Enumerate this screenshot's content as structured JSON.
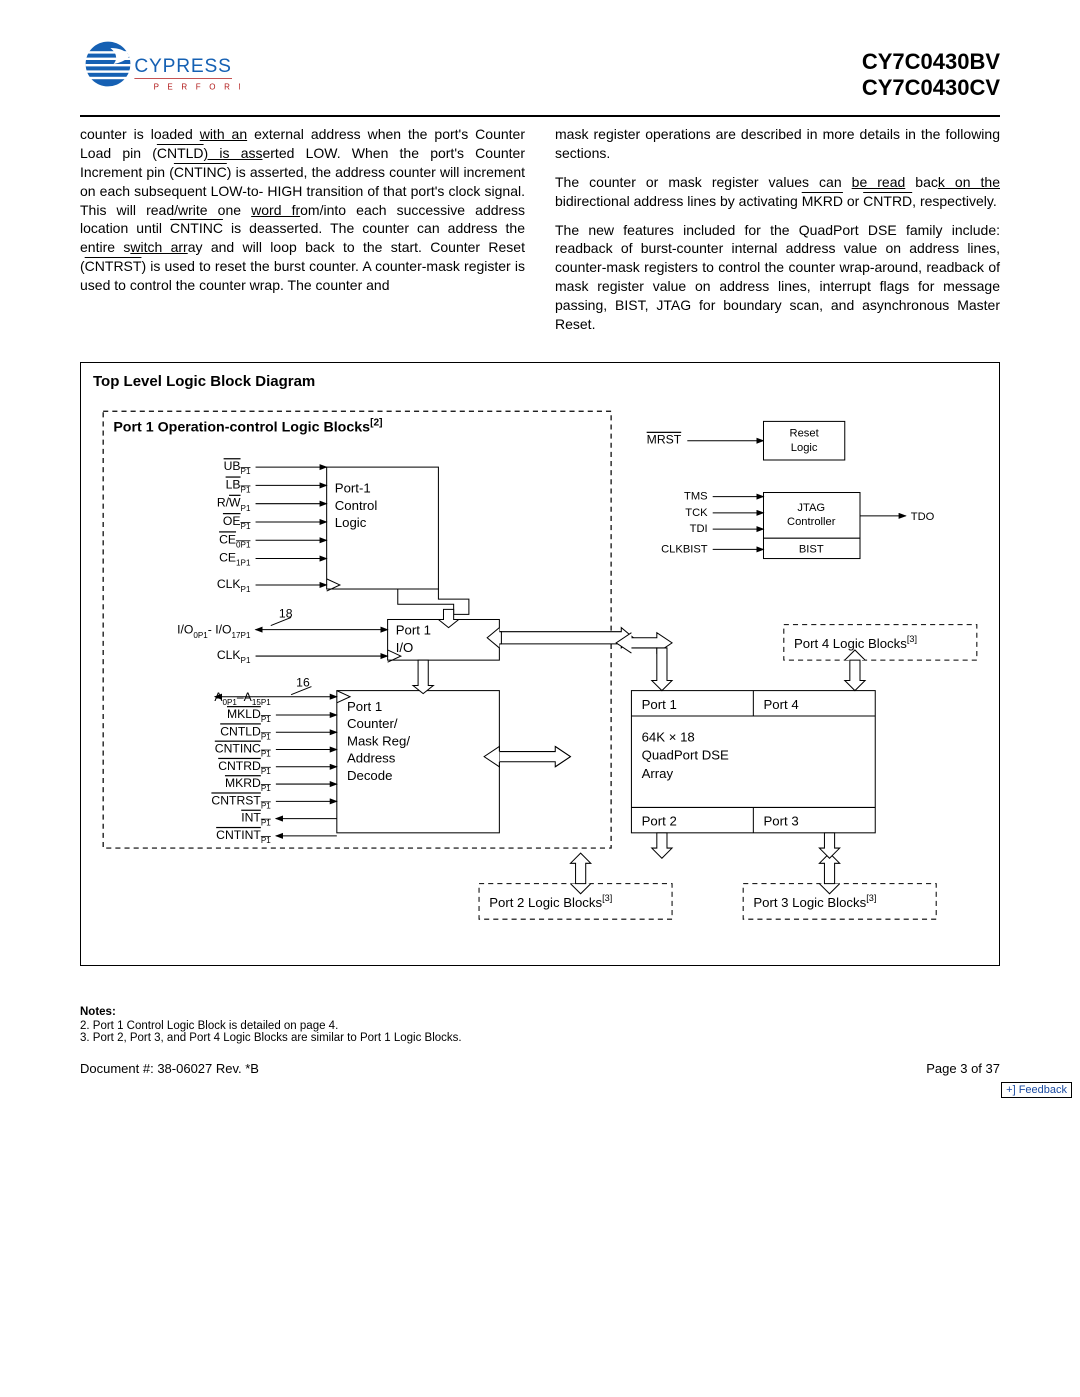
{
  "header": {
    "part1": "CY7C0430BV",
    "part2": "CY7C0430CV",
    "logo_name": "CYPRESS",
    "logo_tag": "P E R F O R M"
  },
  "body": {
    "left_para": "counter is loaded with an external address when the port's Counter Load pin (CNTLD) is asserted LOW. When the port's Counter Increment pin (CNTINC) is asserted, the address counter will increment on each subsequent LOW-to- HIGH transition of that port's clock signal. This will read/write one word from/into each successive address location until CNTINC is deasserted. The counter can address the entire switch array and will loop back to the start. Counter Reset (CNTRST) is used to reset the burst counter. A counter-mask register is used to control the counter wrap. The counter and",
    "right_p1": "mask register operations are described in more details in the following sections.",
    "right_p2": "The counter or mask register values can be read back on the bidirectional address lines by activating MKRD or CNTRD, respectively.",
    "right_p3": "The new features included for the QuadPort DSE family include: readback of burst-counter internal address value on address lines, counter-mask registers to control the counter wrap-around, readback of mask register value on address lines, interrupt flags for message passing, BIST, JTAG for boundary scan, and asynchronous Master Reset."
  },
  "diagram": {
    "title": "Top Level Logic Block Diagram",
    "port1_title": "Port 1 Operation-control Logic Blocks",
    "port1_note_ref": "[2]",
    "ctrl_block": {
      "l1": "Port-1",
      "l2": "Control",
      "l3": "Logic"
    },
    "io_block": {
      "l1": "Port 1",
      "l2": "I/O"
    },
    "counter_block": {
      "l1": "Port 1",
      "l2": "Counter/",
      "l3": "Mask Reg/",
      "l4": "Address",
      "l5": "Decode"
    },
    "array": {
      "l1": "Port 1",
      "l2": "Port 4",
      "l3": "64K × 18",
      "l4": "QuadPort DSE",
      "l5": "Array",
      "l6": "Port 2",
      "l7": "Port 3"
    },
    "mrst": "MRST",
    "reset_logic": {
      "l1": "Reset",
      "l2": "Logic"
    },
    "jtag": {
      "l1": "JTAG",
      "l2": "Controller"
    },
    "bist_label": "BIST",
    "tms": "TMS",
    "tck": "TCK",
    "tdi": "TDI",
    "tdo": "TDO",
    "clkbist": "CLKBIST",
    "logic2": "Port 2 Logic Blocks",
    "logic3": "Port 3 Logic Blocks",
    "logic4": "Port 4 Logic Blocks",
    "ref3": "[3]",
    "bus18": "18",
    "bus16": "16",
    "signals": {
      "ub": "UB",
      "lb": "LB",
      "rw": "R/W",
      "oe": "OE",
      "ce0": "CE",
      "ce1": "CE",
      "clk": "CLK",
      "io": "I/O",
      "io_range": "- I/O",
      "addr": "A",
      "addr_to": "–A",
      "mkld": "MKLD",
      "cntld": "CNTLD",
      "cntinc": "CNTINC",
      "cntrd": "CNTRD",
      "mkrd": "MKRD",
      "cntrst": "CNTRST",
      "int": "INT",
      "cntint": "CNTINT",
      "sub_p1": "P1",
      "sub_0p1": "0P1",
      "sub_1p1": "1P1",
      "sub_17p1": "17P1",
      "sub_15p1": "15P1"
    }
  },
  "notes": {
    "heading": "Notes:",
    "n2": "2.  Port 1 Control Logic Block is detailed on page 4.",
    "n3": "3.  Port 2, Port 3, and Port 4 Logic Blocks are similar to Port 1 Logic Blocks."
  },
  "footer": {
    "doc": "Document #: 38-06027 Rev. *B",
    "page": "Page 3 of 37",
    "feedback": "+] Feedback"
  }
}
